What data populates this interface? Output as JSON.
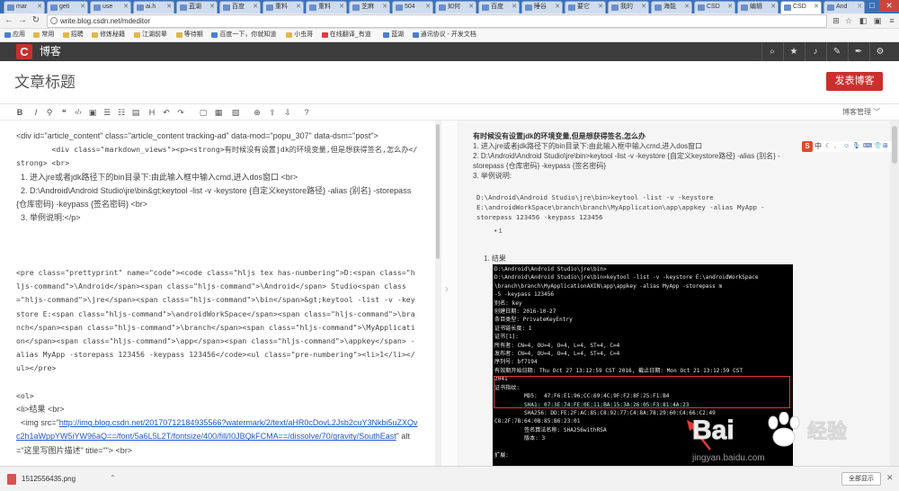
{
  "browser": {
    "tabs": [
      {
        "label": "mar",
        "active": false
      },
      {
        "label": "geti",
        "active": false
      },
      {
        "label": "use",
        "active": false
      },
      {
        "label": "ai.h",
        "active": false
      },
      {
        "label": "蓝湖",
        "active": false
      },
      {
        "label": "百度",
        "active": false
      },
      {
        "label": "重料",
        "active": false
      },
      {
        "label": "重料",
        "active": false
      },
      {
        "label": "芝麻",
        "active": false
      },
      {
        "label": "504",
        "active": false
      },
      {
        "label": "如何",
        "active": false
      },
      {
        "label": "百度",
        "active": false
      },
      {
        "label": "睡谷",
        "active": false
      },
      {
        "label": "要它",
        "active": false
      },
      {
        "label": "我的",
        "active": false
      },
      {
        "label": "海能",
        "active": false
      },
      {
        "label": "CSD",
        "active": false
      },
      {
        "label": "编辑",
        "active": false
      },
      {
        "label": "CSD",
        "active": true
      },
      {
        "label": "And",
        "active": false
      }
    ],
    "url": "write.blog.csdn.net/mdeditor",
    "bookmarks": [
      {
        "label": "应用",
        "kind": "b"
      },
      {
        "label": "常用",
        "kind": "f"
      },
      {
        "label": "招聘",
        "kind": "f"
      },
      {
        "label": "修炼秘籍",
        "kind": "f"
      },
      {
        "label": "江湖前辈",
        "kind": "f"
      },
      {
        "label": "等待期",
        "kind": "f"
      },
      {
        "label": "百度一下，你就知道",
        "kind": "b"
      },
      {
        "label": "小虫哥",
        "kind": "f"
      },
      {
        "label": "在线翻译_有道",
        "kind": "y"
      },
      {
        "label": "蓝湖",
        "kind": "b"
      },
      {
        "label": "通讯协议 - 开发文档",
        "kind": "b"
      }
    ]
  },
  "csdn": {
    "logo_letter": "C",
    "brand": "博客",
    "header_icons": [
      "search-icon",
      "star-icon",
      "bell-icon",
      "edit-icon",
      "pen-icon",
      "gear-icon"
    ]
  },
  "editor": {
    "title_placeholder": "文章标题",
    "publish_label": "发表博客",
    "toolbar_icons": [
      "B",
      "I",
      "🔗",
      "❝",
      "</>",
      "▣",
      "☰",
      "☷",
      "▬",
      "H",
      "—",
      "↶",
      "↷",
      "▢",
      "▤",
      "▦",
      "⇪",
      "⇩",
      "?"
    ],
    "manage_label": "博客管理 ﹀"
  },
  "source": {
    "lines": [
      {
        "text": "<div id=\"article_content\" class=\"article_content tracking-ad\" data-mod=\"popu_307\" data-dsm=\"post\">",
        "mono": false
      },
      {
        "text": "        <div class=\"markdown_views\"><p><strong>有时候没有设置jdk的环境变量,但是想获得签名,怎么办</strong> <br>",
        "mono": true
      },
      {
        "text": "  1. 进入jre或者jdk路径下的bin目录下:由此输入框中输入cmd,进入dos窗口 <br>",
        "mono": false
      },
      {
        "text": "  2. D:\\Android\\Android Studio\\jre\\bin&gt;keytool -list -v -keystore {自定义keystore路径} -alias {别名} -storepass {仓库密码} -keypass {签名密码} <br>",
        "mono": false
      },
      {
        "text": "  3. 举例说明:</p>",
        "mono": false
      },
      {
        "text": " ",
        "mono": false
      },
      {
        "text": " ",
        "mono": false
      },
      {
        "text": " ",
        "mono": false
      },
      {
        "text": "<pre class=\"prettyprint\" name=\"code\"><code class=\"hljs tex has-numbering\">D:<span class=\"hljs-command\">\\Android</span><span class=\"hljs-command\">\\Android</span> Studio<span class=\"hljs-command\">\\jre</span><span class=\"hljs-command\">\\bin</span>&gt;keytool -list -v -keystore E:<span class=\"hljs-command\">\\androidWorkSpace</span><span class=\"hljs-command\">\\branch</span><span class=\"hljs-command\">\\branch</span><span class=\"hljs-command\">\\MyApplication</span><span class=\"hljs-command\">\\app</span><span class=\"hljs-command\">\\appkey</span> -alias MyApp -storepass 123456 -keypass 123456</code><ul class=\"pre-numbering\"><li>1</li></ul></pre>",
        "mono": true
      },
      {
        "text": " ",
        "mono": false
      },
      {
        "text": "<ol>",
        "mono": true
      },
      {
        "text": "<li>结果 <br>",
        "mono": false
      },
      {
        "text": "  <img src=\"",
        "mono": false,
        "url": "http://img.blog.csdn.net/20170712184935566?watermark/2/text/aHR0cDovL2Jsb2cuY3Nkbi5uZXQvc2h1aWppYW5iYW96aQ==/font/5a6L5L2T/fontsize/400/fill/I0JBQkFCMA==/dissolve/70/gravity/SouthEast",
        "tail": "\" alt=\"这里写图片描述\" title=\"\"> <br>"
      }
    ]
  },
  "preview": {
    "heading": "有时候没有设置jdk的环境变量,但是想获得签名,怎么办",
    "steps": [
      "1. 进入jre或者jdk路径下的bin目录下:由此输入框中输入cmd,进入dos窗口",
      "2. D:\\Android\\Android Studio\\jre\\bin>keytool -list -v -keystore {自定义keystore路径} -alias {别名} -storepass {仓库密码} -keypass {签名密码}",
      "3. 举例说明:"
    ],
    "code": "D:\\Android\\Android Studio\\jre\\bin>keytool -list -v -keystore E:\\androidWorkSpace\\branch\\branch\\MyApplication\\app\\appkey -alias MyApp -storepass 123456 -keypass 123456",
    "bullet": "• 1",
    "result_label": "1. 结果",
    "cmd_lines": [
      "D:\\Android\\Android Studio\\jre\\bin>",
      "D:\\Android\\Android Studio\\jre\\bin>keytool -list -v -keystore E:\\androidWorkSpace",
      "\\branch\\branch\\MyApplicationAXIN\\app\\appkey -alias MyApp -storepass m",
      "-5 -keypass 123456",
      "别名: key",
      "创建日期: 2016-10-27",
      "条目类型: PrivateKeyEntry",
      "证书链长度: 1",
      "证书[1]:",
      "所有者: CN=4, OU=4, O=4, L=4, ST=4, C=4",
      "发布者: CN=4, OU=4, O=4, L=4, ST=4, C=4",
      "序列号: bf7194",
      "有效期开始日期: Thu Oct 27 13:12:59 CST 2016, 截止日期: Mon Oct 21 13:12:59 CST",
      "2041",
      "证书指纹:",
      "         MD5:  47:F6:E1:96:CC:69:4C:9F:F2:8F:25:F1:B4",
      "         SHA1: 07:3E:74:FE:0E:11:BA:15:3A:26:05:F3:81:4A:23",
      "         SHA256: DD:FE:2F:AC:85:C8:92:77:C4:8A:78:29:60:C4:66:C2:49",
      "C8:2F:7B:64:0B:85:B6:23:01",
      "         签名算法名称: SHA256withRSA",
      "         版本: 3",
      " ",
      "扩展:",
      " ",
      "#1: ObjectId: 2.5.29.14 Criticality=false",
      "SubjectKeyIdentifier [",
      "KeyIdentifier ["
    ]
  },
  "ime": {
    "logo": "S",
    "lang": "中"
  },
  "watermark": {
    "brand": "Bai",
    "jy": "经验",
    "url": "jingyan.baidu.com"
  },
  "download": {
    "file": "1512556435.png",
    "show_all": "全部显示"
  }
}
